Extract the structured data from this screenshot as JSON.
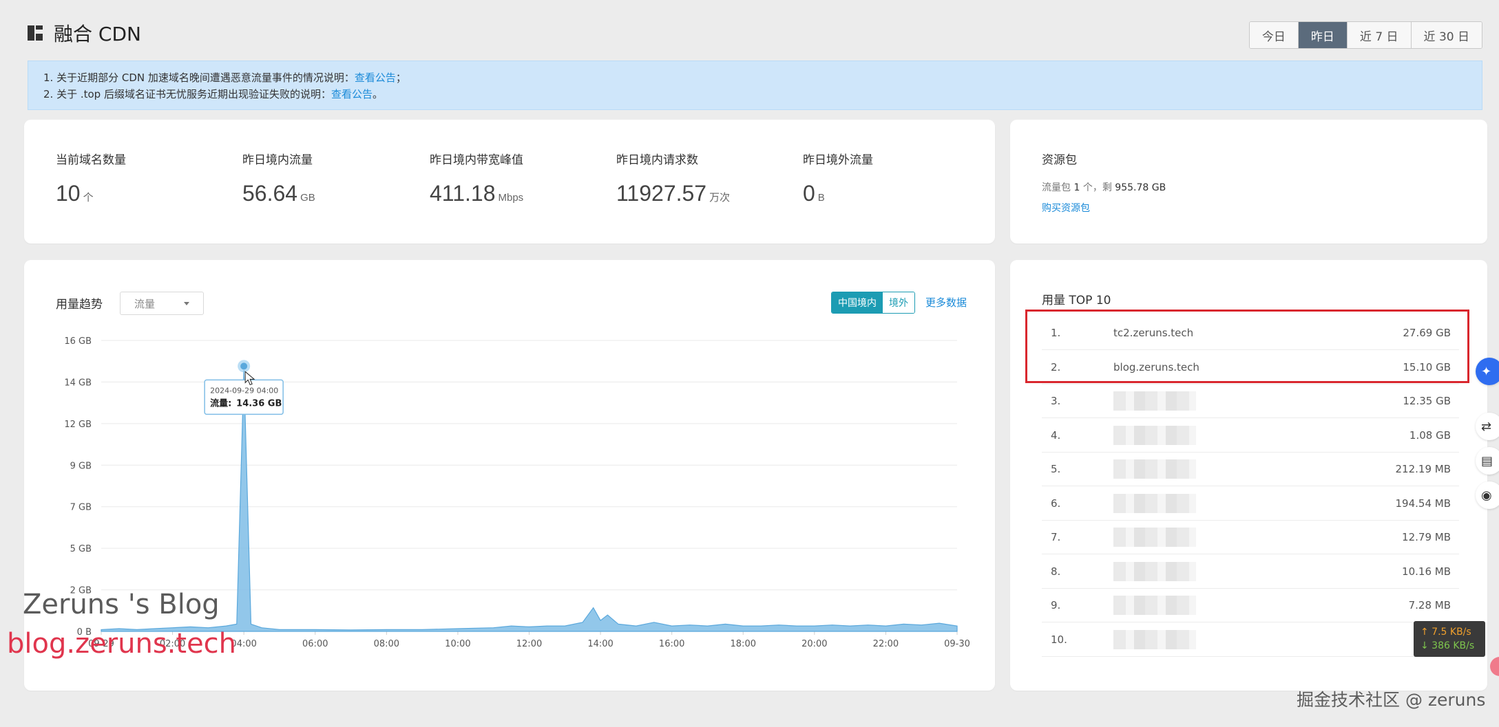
{
  "header": {
    "title": "融合 CDN",
    "ranges": [
      "今日",
      "昨日",
      "近 7 日",
      "近 30 日"
    ],
    "active_range": "昨日"
  },
  "notice": {
    "line1_text": "1. 关于近期部分 CDN 加速域名晚间遭遇恶意流量事件的情况说明：",
    "line1_link": "查看公告",
    "line1_suffix": "；",
    "line2_text": "2. 关于 .top 后缀域名证书无忧服务近期出现验证失败的说明：",
    "line2_link": "查看公告",
    "line2_suffix": "。"
  },
  "stats": [
    {
      "label": "当前域名数量",
      "value": "10",
      "unit": "个"
    },
    {
      "label": "昨日境内流量",
      "value": "56.64",
      "unit": "GB"
    },
    {
      "label": "昨日境内带宽峰值",
      "value": "411.18",
      "unit": "Mbps"
    },
    {
      "label": "昨日境内请求数",
      "value": "11927.57",
      "unit": "万次"
    },
    {
      "label": "昨日境外流量",
      "value": "0",
      "unit": "B"
    }
  ],
  "pack": {
    "title": "资源包",
    "info_prefix": "流量包",
    "count": "1",
    "info_mid": "个，剩",
    "remaining": "955.78 GB",
    "buy_link": "购买资源包"
  },
  "usage_chart": {
    "title": "用量趋势",
    "metric_select": "流量",
    "region_active": "中国境内",
    "region_other": "境外",
    "more_link": "更多数据",
    "tooltip_time": "2024-09-29 04:00",
    "tooltip_label": "流量:",
    "tooltip_value": "14.36 GB",
    "accent_color": "#1c9cb3",
    "fill_color": "#7fbde6"
  },
  "chart_data": {
    "type": "area",
    "title": "",
    "xlabel": "",
    "ylabel": "",
    "x_ticks": [
      "09-29",
      "02:00",
      "04:00",
      "06:00",
      "08:00",
      "10:00",
      "12:00",
      "14:00",
      "16:00",
      "18:00",
      "20:00",
      "22:00",
      "09-30"
    ],
    "y_ticks": [
      "0 B",
      "2 GB",
      "5 GB",
      "7 GB",
      "9 GB",
      "12 GB",
      "14 GB",
      "16 GB"
    ],
    "ylim": [
      0,
      16
    ],
    "y_unit": "GB",
    "series": [
      {
        "name": "流量",
        "hours": [
          0,
          0.5,
          1,
          1.5,
          2,
          2.5,
          3,
          3.5,
          3.8,
          4,
          4.2,
          4.5,
          5,
          6,
          7,
          8,
          9,
          10,
          11,
          11.5,
          12,
          12.5,
          13,
          13.5,
          13.8,
          14,
          14.2,
          14.5,
          15,
          15.5,
          16,
          16.5,
          17,
          17.5,
          18,
          18.5,
          19,
          19.5,
          20,
          20.5,
          21,
          21.5,
          22,
          22.5,
          23,
          23.5,
          24
        ],
        "values": [
          0.1,
          0.15,
          0.1,
          0.15,
          0.2,
          0.25,
          0.2,
          0.3,
          0.4,
          14.36,
          0.4,
          0.2,
          0.1,
          0.1,
          0.08,
          0.1,
          0.1,
          0.15,
          0.2,
          0.3,
          0.25,
          0.3,
          0.3,
          0.5,
          1.3,
          0.6,
          0.9,
          0.4,
          0.3,
          0.5,
          0.3,
          0.35,
          0.3,
          0.4,
          0.3,
          0.3,
          0.35,
          0.3,
          0.3,
          0.35,
          0.3,
          0.35,
          0.3,
          0.4,
          0.35,
          0.45,
          0.3
        ]
      }
    ]
  },
  "top10": {
    "title": "用量 TOP 10",
    "rows": [
      {
        "rank": "1.",
        "domain": "tc2.zeruns.tech",
        "usage": "27.69 GB"
      },
      {
        "rank": "2.",
        "domain": "blog.zeruns.tech",
        "usage": "15.10 GB"
      },
      {
        "rank": "3.",
        "domain": "",
        "usage": "12.35 GB"
      },
      {
        "rank": "4.",
        "domain": "",
        "usage": "1.08 GB"
      },
      {
        "rank": "5.",
        "domain": "",
        "usage": "212.19 MB"
      },
      {
        "rank": "6.",
        "domain": "",
        "usage": "194.54 MB"
      },
      {
        "rank": "7.",
        "domain": "",
        "usage": "12.79 MB"
      },
      {
        "rank": "8.",
        "domain": "",
        "usage": "10.16 MB"
      },
      {
        "rank": "9.",
        "domain": "",
        "usage": "7.28 MB"
      },
      {
        "rank": "10.",
        "domain": "",
        "usage": ""
      }
    ]
  },
  "speed": {
    "up": "↑ 7.5 KB/s",
    "down": "↓ 386 KB/s"
  },
  "watermarks": {
    "blog_name": "Zeruns 's Blog",
    "blog_url": "blog.zeruns.tech",
    "juejin": "掘金技术社区 @ zeruns"
  }
}
